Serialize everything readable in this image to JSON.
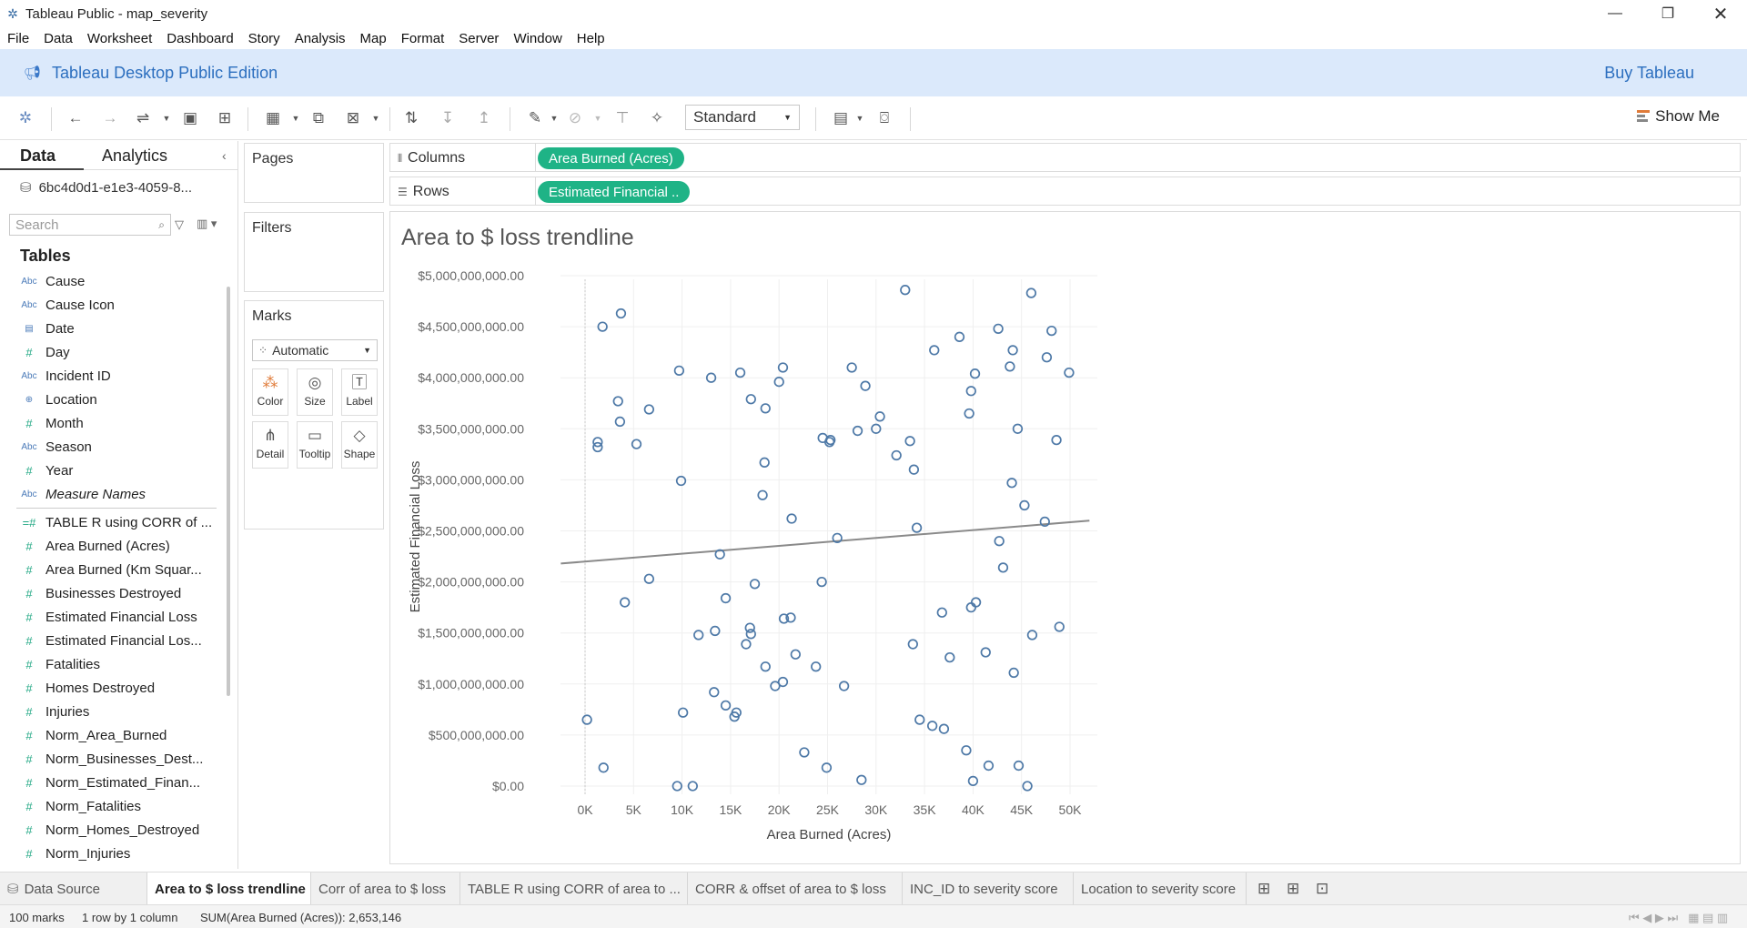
{
  "window": {
    "title": "Tableau Public - map_severity"
  },
  "menu": [
    "File",
    "Data",
    "Worksheet",
    "Dashboard",
    "Story",
    "Analysis",
    "Map",
    "Format",
    "Server",
    "Window",
    "Help"
  ],
  "banner": {
    "text": "Tableau Desktop Public Edition",
    "buy": "Buy Tableau"
  },
  "toolbar": {
    "fit_select": "Standard",
    "show_me": "Show Me"
  },
  "left_panel": {
    "tab_data": "Data",
    "tab_analytics": "Analytics",
    "data_source": "6bc4d0d1-e1e3-4059-8...",
    "search_placeholder": "Search",
    "tables_heading": "Tables",
    "dimensions": [
      {
        "type": "Abc",
        "name": "Cause"
      },
      {
        "type": "Abc",
        "name": "Cause Icon"
      },
      {
        "type": "date",
        "name": "Date"
      },
      {
        "type": "#",
        "name": "Day"
      },
      {
        "type": "Abc",
        "name": "Incident ID"
      },
      {
        "type": "geo",
        "name": "Location"
      },
      {
        "type": "#",
        "name": "Month"
      },
      {
        "type": "Abc",
        "name": "Season"
      },
      {
        "type": "#",
        "name": "Year"
      },
      {
        "type": "Abc",
        "name": "Measure Names"
      }
    ],
    "measures": [
      "TABLE R using CORR of ...",
      "Area Burned (Acres)",
      "Area Burned (Km Squar...",
      "Businesses Destroyed",
      "Estimated Financial Loss",
      "Estimated Financial Los...",
      "Fatalities",
      "Homes Destroyed",
      "Injuries",
      "Norm_Area_Burned",
      "Norm_Businesses_Dest...",
      "Norm_Estimated_Finan...",
      "Norm_Fatalities",
      "Norm_Homes_Destroyed",
      "Norm_Injuries"
    ]
  },
  "cards": {
    "pages": "Pages",
    "filters": "Filters",
    "marks": "Marks",
    "mark_type": "Automatic",
    "mark_buttons": [
      "Color",
      "Size",
      "Label",
      "Detail",
      "Tooltip",
      "Shape"
    ]
  },
  "shelves": {
    "columns_label": "Columns",
    "columns_pill": "Area Burned (Acres)",
    "rows_label": "Rows",
    "rows_pill": "Estimated Financial .."
  },
  "sheet_tabs": {
    "data_source": "Data Source",
    "tabs": [
      "Area to $ loss trendline",
      "Corr of area to $ loss",
      "TABLE R using CORR of area to ...",
      "CORR & offset of area to $ loss",
      "INC_ID to severity score",
      "Location to severity score"
    ]
  },
  "status": {
    "marks": "100 marks",
    "layout": "1 row by 1 column",
    "sum": "SUM(Area Burned (Acres)): 2,653,146"
  },
  "chart_data": {
    "type": "scatter",
    "title": "Area to $ loss trendline",
    "xlabel": "Area Burned (Acres)",
    "ylabel": "Estimated Financial Loss",
    "xlim": [
      -2000,
      52000
    ],
    "ylim": [
      0,
      5000000000
    ],
    "x_ticks": [
      0,
      5000,
      10000,
      15000,
      20000,
      25000,
      30000,
      35000,
      40000,
      45000,
      50000
    ],
    "x_tick_labels": [
      "0K",
      "5K",
      "10K",
      "15K",
      "20K",
      "25K",
      "30K",
      "35K",
      "40K",
      "45K",
      "50K"
    ],
    "y_ticks": [
      0,
      500000000,
      1000000000,
      1500000000,
      2000000000,
      2500000000,
      3000000000,
      3500000000,
      4000000000,
      4500000000,
      5000000000
    ],
    "y_tick_labels": [
      "$0.00",
      "$500,000,000.00",
      "$1,000,000,000.00",
      "$1,500,000,000.00",
      "$2,000,000,000.00",
      "$2,500,000,000.00",
      "$3,000,000,000.00",
      "$3,500,000,000.00",
      "$4,000,000,000.00",
      "$4,500,000,000.00",
      "$5,000,000,000.00"
    ],
    "marker_color": "#4e79a7",
    "trendline_color": "#8a8a8a",
    "trendline": {
      "x": [
        -2500,
        52000
      ],
      "y": [
        2180000000,
        2600000000
      ]
    },
    "points": [
      [
        200,
        650000000
      ],
      [
        1300,
        3320000000
      ],
      [
        1300,
        3370000000
      ],
      [
        1800,
        4500000000
      ],
      [
        1900,
        180000000
      ],
      [
        3400,
        3770000000
      ],
      [
        3600,
        3570000000
      ],
      [
        3700,
        4630000000
      ],
      [
        4100,
        1800000000
      ],
      [
        5300,
        3350000000
      ],
      [
        6600,
        3690000000
      ],
      [
        6600,
        2030000000
      ],
      [
        9500,
        0
      ],
      [
        9700,
        4070000000
      ],
      [
        9900,
        2990000000
      ],
      [
        10100,
        720000000
      ],
      [
        11100,
        0
      ],
      [
        11700,
        1480000000
      ],
      [
        13000,
        4000000000
      ],
      [
        13300,
        920000000
      ],
      [
        13400,
        1520000000
      ],
      [
        13900,
        2270000000
      ],
      [
        14500,
        790000000
      ],
      [
        14500,
        1840000000
      ],
      [
        15400,
        680000000
      ],
      [
        15600,
        720000000
      ],
      [
        16000,
        4050000000
      ],
      [
        16600,
        1390000000
      ],
      [
        17000,
        1550000000
      ],
      [
        17100,
        1490000000
      ],
      [
        17100,
        3790000000
      ],
      [
        17500,
        1980000000
      ],
      [
        18300,
        2850000000
      ],
      [
        18600,
        1170000000
      ],
      [
        18600,
        3700000000
      ],
      [
        18500,
        3170000000
      ],
      [
        19600,
        980000000
      ],
      [
        20000,
        3960000000
      ],
      [
        20400,
        1020000000
      ],
      [
        20500,
        1640000000
      ],
      [
        20400,
        4100000000
      ],
      [
        21200,
        1650000000
      ],
      [
        21300,
        2620000000
      ],
      [
        21700,
        1290000000
      ],
      [
        22600,
        330000000
      ],
      [
        23800,
        1170000000
      ],
      [
        24400,
        2000000000
      ],
      [
        24500,
        3410000000
      ],
      [
        24900,
        180000000
      ],
      [
        25200,
        3370000000
      ],
      [
        25300,
        3390000000
      ],
      [
        26000,
        2430000000
      ],
      [
        26700,
        980000000
      ],
      [
        27500,
        4100000000
      ],
      [
        28100,
        3480000000
      ],
      [
        28500,
        60000000
      ],
      [
        28900,
        3920000000
      ],
      [
        30000,
        3500000000
      ],
      [
        30400,
        3620000000
      ],
      [
        32100,
        3240000000
      ],
      [
        33000,
        4860000000
      ],
      [
        33500,
        3380000000
      ],
      [
        33800,
        1390000000
      ],
      [
        33900,
        3100000000
      ],
      [
        34200,
        2530000000
      ],
      [
        34500,
        650000000
      ],
      [
        35800,
        590000000
      ],
      [
        36000,
        4270000000
      ],
      [
        36800,
        1700000000
      ],
      [
        37000,
        560000000
      ],
      [
        37600,
        1260000000
      ],
      [
        38600,
        4400000000
      ],
      [
        39300,
        350000000
      ],
      [
        39600,
        3650000000
      ],
      [
        39800,
        3870000000
      ],
      [
        39800,
        1750000000
      ],
      [
        40200,
        4040000000
      ],
      [
        40300,
        1800000000
      ],
      [
        40000,
        50000000
      ],
      [
        41300,
        1310000000
      ],
      [
        41600,
        200000000
      ],
      [
        42600,
        4480000000
      ],
      [
        42700,
        2400000000
      ],
      [
        43100,
        2140000000
      ],
      [
        43800,
        4110000000
      ],
      [
        44000,
        2970000000
      ],
      [
        44100,
        4270000000
      ],
      [
        44200,
        1110000000
      ],
      [
        44600,
        3500000000
      ],
      [
        44700,
        200000000
      ],
      [
        45300,
        2750000000
      ],
      [
        45600,
        0
      ],
      [
        46000,
        4830000000
      ],
      [
        46100,
        1480000000
      ],
      [
        47400,
        2590000000
      ],
      [
        47600,
        4200000000
      ],
      [
        48100,
        4460000000
      ],
      [
        48600,
        3390000000
      ],
      [
        48900,
        1560000000
      ],
      [
        49900,
        4050000000
      ]
    ]
  }
}
